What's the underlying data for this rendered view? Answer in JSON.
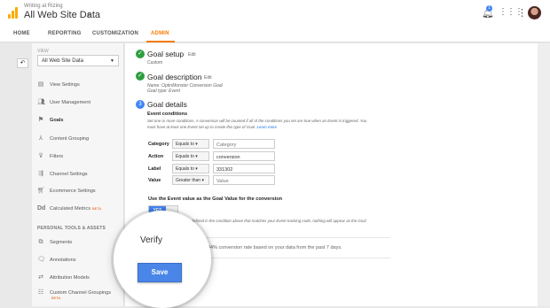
{
  "header": {
    "account_small": "Writing at Rizing",
    "account_name": "All Web Site Data",
    "notification_count": "1"
  },
  "nav": {
    "tabs": [
      "HOME",
      "REPORTING",
      "CUSTOMIZATION",
      "ADMIN"
    ],
    "active_tab": "ADMIN"
  },
  "sidebar": {
    "view_label": "VIEW",
    "view_selected": "All Web Site Data",
    "items": [
      {
        "label": "View Settings",
        "icon": "document-icon"
      },
      {
        "label": "User Management",
        "icon": "users-icon"
      },
      {
        "label": "Goals",
        "icon": "flag-icon"
      },
      {
        "label": "Content Grouping",
        "icon": "hierarchy-icon"
      },
      {
        "label": "Filters",
        "icon": "filter-icon"
      },
      {
        "label": "Channel Settings",
        "icon": "channel-icon"
      },
      {
        "label": "Ecommerce Settings",
        "icon": "cart-icon"
      },
      {
        "label": "Calculated Metrics",
        "icon": "dd-icon",
        "badge": "BETA"
      }
    ],
    "section_heading": "PERSONAL TOOLS & ASSETS",
    "personal_items": [
      {
        "label": "Segments",
        "icon": "segments-icon"
      },
      {
        "label": "Annotations",
        "icon": "annotation-icon"
      },
      {
        "label": "Attribution Models",
        "icon": "attribution-icon"
      },
      {
        "label": "Custom Channel Groupings",
        "icon": "channel-group-icon",
        "badge": "BETA"
      }
    ]
  },
  "goal": {
    "setup": {
      "title": "Goal setup",
      "edit": "Edit",
      "value": "Custom"
    },
    "description": {
      "title": "Goal description",
      "edit": "Edit",
      "name": "Name: OptinMonster Conversion Goal",
      "type": "Goal type: Event"
    },
    "details": {
      "step": "3",
      "title": "Goal details",
      "conditions_heading": "Event conditions",
      "conditions_help_1": "Set one or more conditions. A conversion will be counted if all of the conditions you set are true when an Event is triggered. You",
      "conditions_help_2": "must have at least one Event set up to create this type of Goal.",
      "learn_more": "Learn more",
      "rows": [
        {
          "label": "Category",
          "operator": "Equals to",
          "value": "",
          "placeholder": "Category"
        },
        {
          "label": "Action",
          "operator": "Equals to",
          "value": "conversion",
          "placeholder": ""
        },
        {
          "label": "Label",
          "operator": "Equals to",
          "value": "331302",
          "placeholder": ""
        },
        {
          "label": "Value",
          "operator": "Greater than",
          "value": "",
          "placeholder": "Value"
        }
      ],
      "use_value_heading": "Use the Event value as the Goal Value for the conversion",
      "toggle_label": "YES",
      "toggle_help": "If you don't have a value defined in the condition above that matches your Event tracking code, nothing will appear as the Goal",
      "toggle_help_2": "Value.",
      "verify_title": "Verify",
      "verify_text": "04% conversion rate based on your data from the past 7 days."
    }
  },
  "save_label": "Save"
}
